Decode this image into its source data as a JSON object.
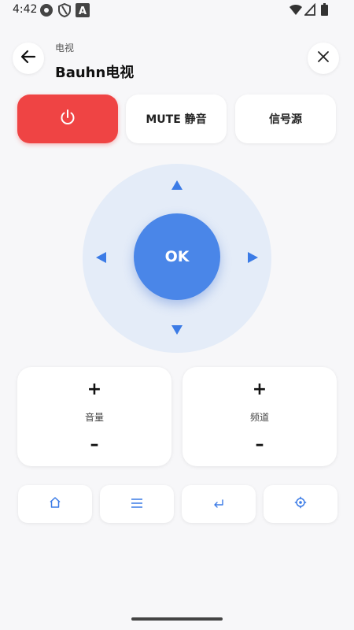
{
  "status_bar": {
    "time": "4:42",
    "icons": [
      "record-icon",
      "shield-icon",
      "font-icon",
      "wifi-icon",
      "signal-icon",
      "battery-icon"
    ]
  },
  "header": {
    "subtitle": "电视",
    "title": "Bauhn电视",
    "back_icon": "arrow-left-icon",
    "close_icon": "close-icon"
  },
  "top_buttons": {
    "power_icon": "power-icon",
    "mute_label": "MUTE 静音",
    "source_label": "信号源"
  },
  "dpad": {
    "ok_label": "OK"
  },
  "volume": {
    "plus": "+",
    "label": "音量",
    "minus": "–"
  },
  "channel": {
    "plus": "+",
    "label": "频道",
    "minus": "–"
  },
  "bottom_nav": {
    "home_icon": "home-icon",
    "menu_icon": "menu-icon",
    "return_icon": "return-icon",
    "settings_icon": "settings-icon"
  },
  "colors": {
    "power": "#ef4444",
    "accent": "#3b7be6",
    "ok": "#4a86e8",
    "dpad_bg": "#e4ecf8",
    "background": "#f7f7f9"
  }
}
